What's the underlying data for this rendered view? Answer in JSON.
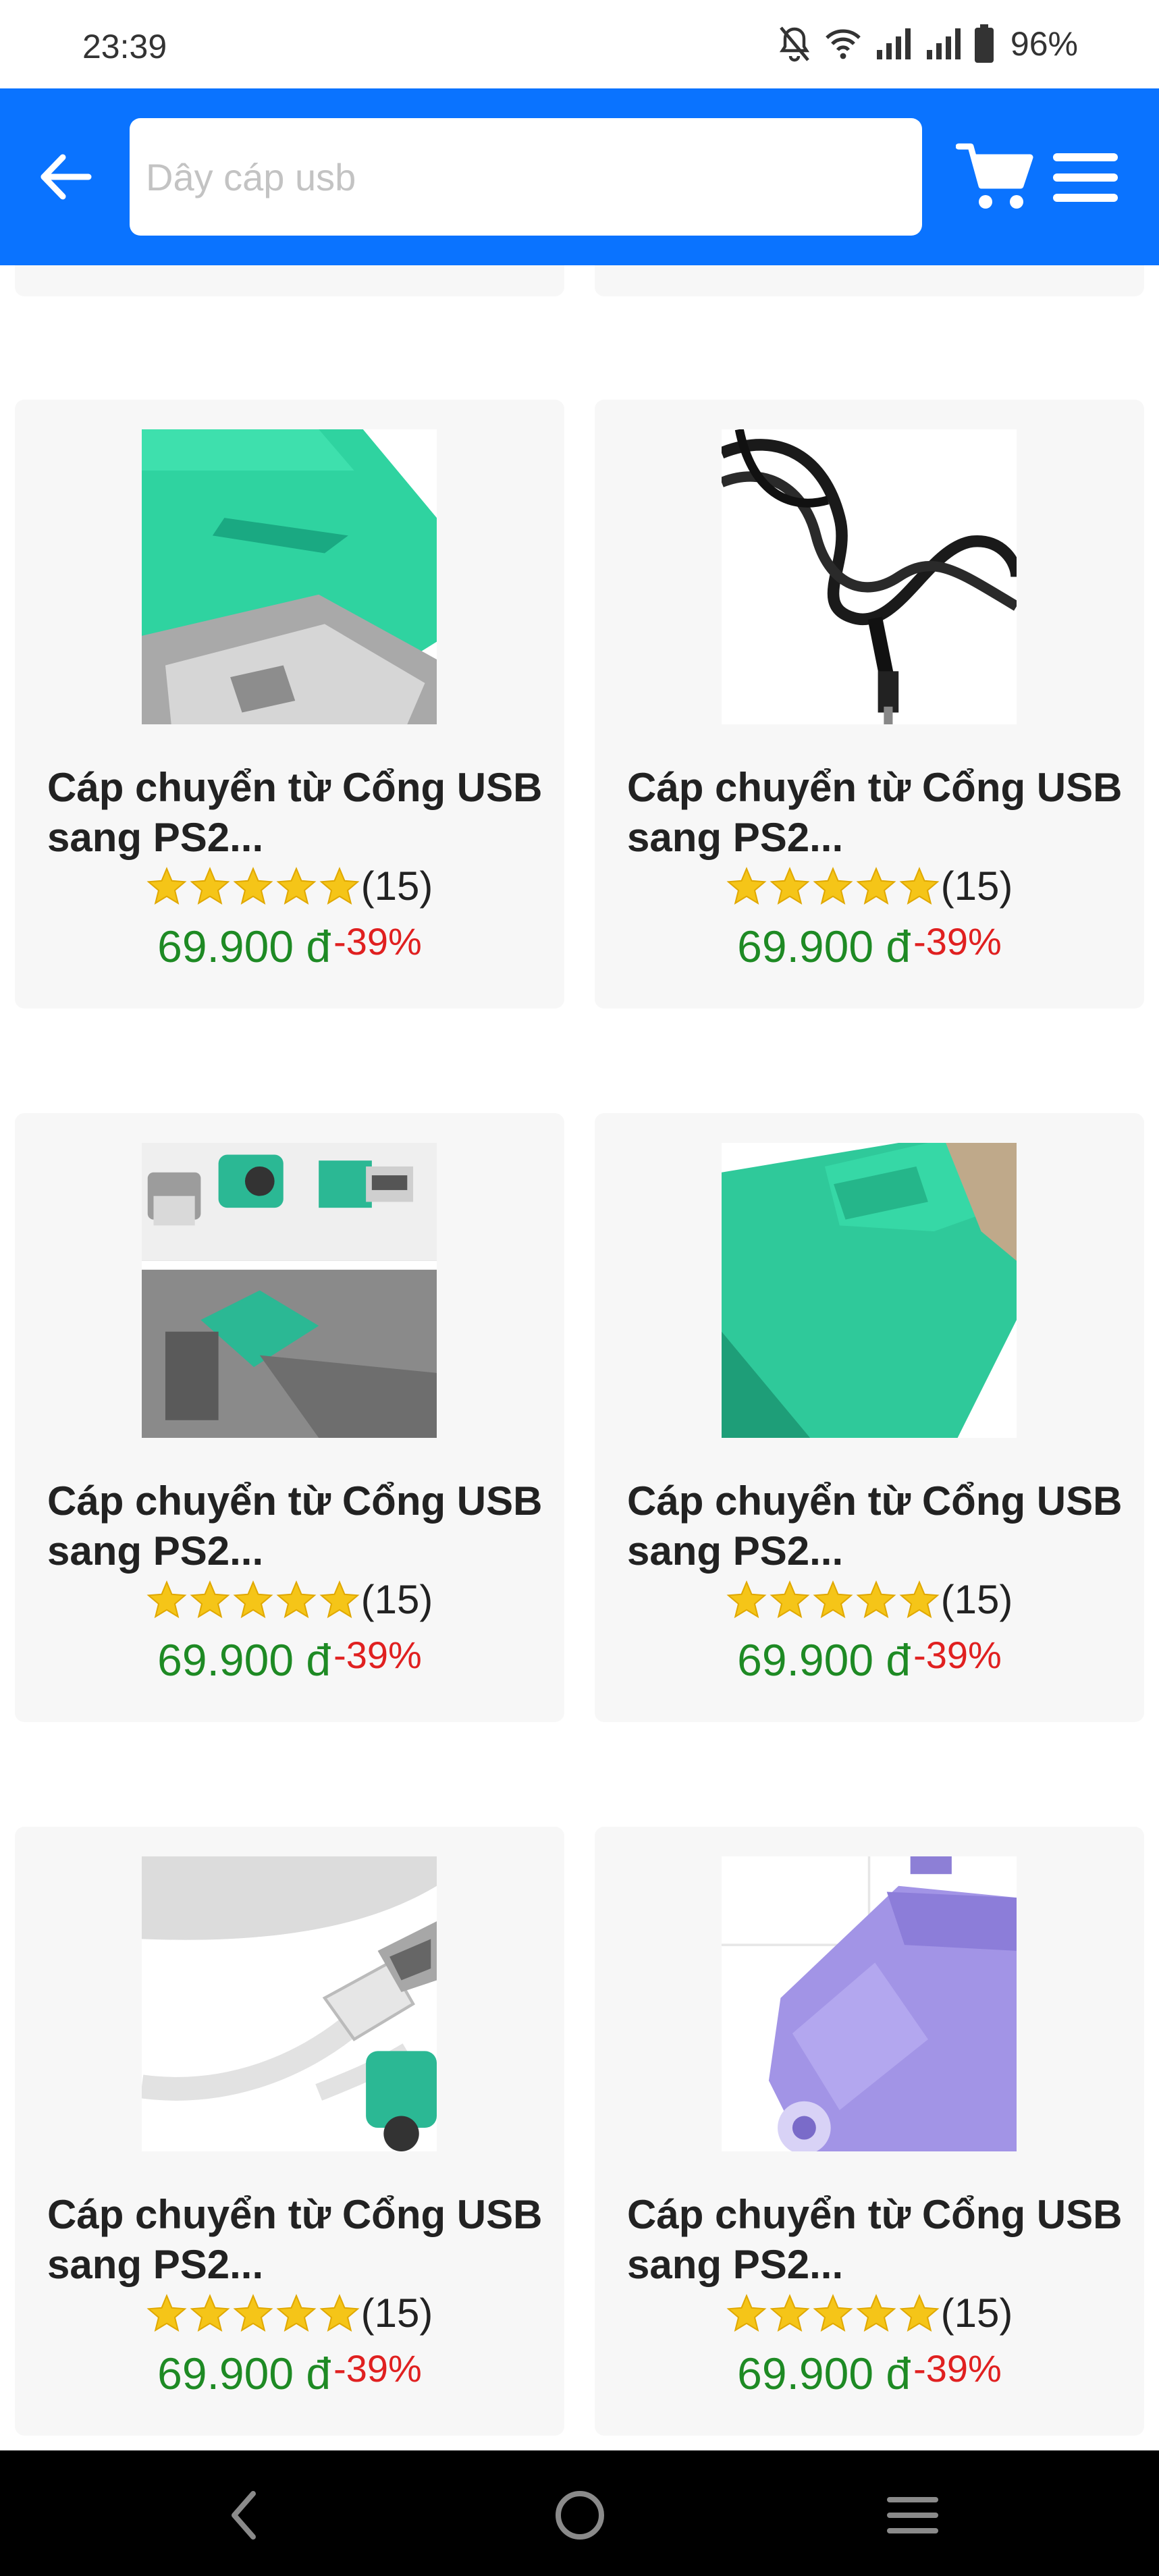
{
  "status_bar": {
    "time": "23:39",
    "battery": "96%",
    "icons": [
      "bell-off-icon",
      "wifi-icon",
      "signal-icon",
      "signal-icon",
      "battery-icon"
    ]
  },
  "header": {
    "back_icon": "arrow-left-icon",
    "search_placeholder": "Dây cáp usb",
    "cart_icon": "cart-icon",
    "menu_icon": "hamburger-menu-icon",
    "color": "#0a73ff"
  },
  "products": [
    {
      "title": "Cáp chuyển từ Cổng USB sang PS2...",
      "rating": 5,
      "rating_count": "(15)",
      "price": "69.900 đ",
      "discount": "-39%"
    },
    {
      "title": "Cáp chuyển từ Cổng USB sang PS2...",
      "rating": 5,
      "rating_count": "(15)",
      "price": "69.900 đ",
      "discount": "-39%"
    },
    {
      "title": "Cáp chuyển từ Cổng USB sang PS2...",
      "rating": 5,
      "rating_count": "(15)",
      "price": "69.900 đ",
      "discount": "-39%"
    },
    {
      "title": "Cáp chuyển từ Cổng USB sang PS2...",
      "rating": 5,
      "rating_count": "(15)",
      "price": "69.900 đ",
      "discount": "-39%"
    },
    {
      "title": "Cáp chuyển từ Cổng USB sang PS2...",
      "rating": 5,
      "rating_count": "(15)",
      "price": "69.900 đ",
      "discount": "-39%"
    },
    {
      "title": "Cáp chuyển từ Cổng USB sang PS2...",
      "rating": 5,
      "rating_count": "(15)",
      "price": "69.900 đ",
      "discount": "-39%"
    }
  ],
  "nav": {
    "back_icon": "nav-back-icon",
    "home_icon": "nav-home-icon",
    "recents_icon": "nav-recents-icon"
  },
  "colors": {
    "price": "#1e8a24",
    "discount": "#e02020",
    "star": "#f5c518",
    "card_bg": "#f7f7f7"
  }
}
